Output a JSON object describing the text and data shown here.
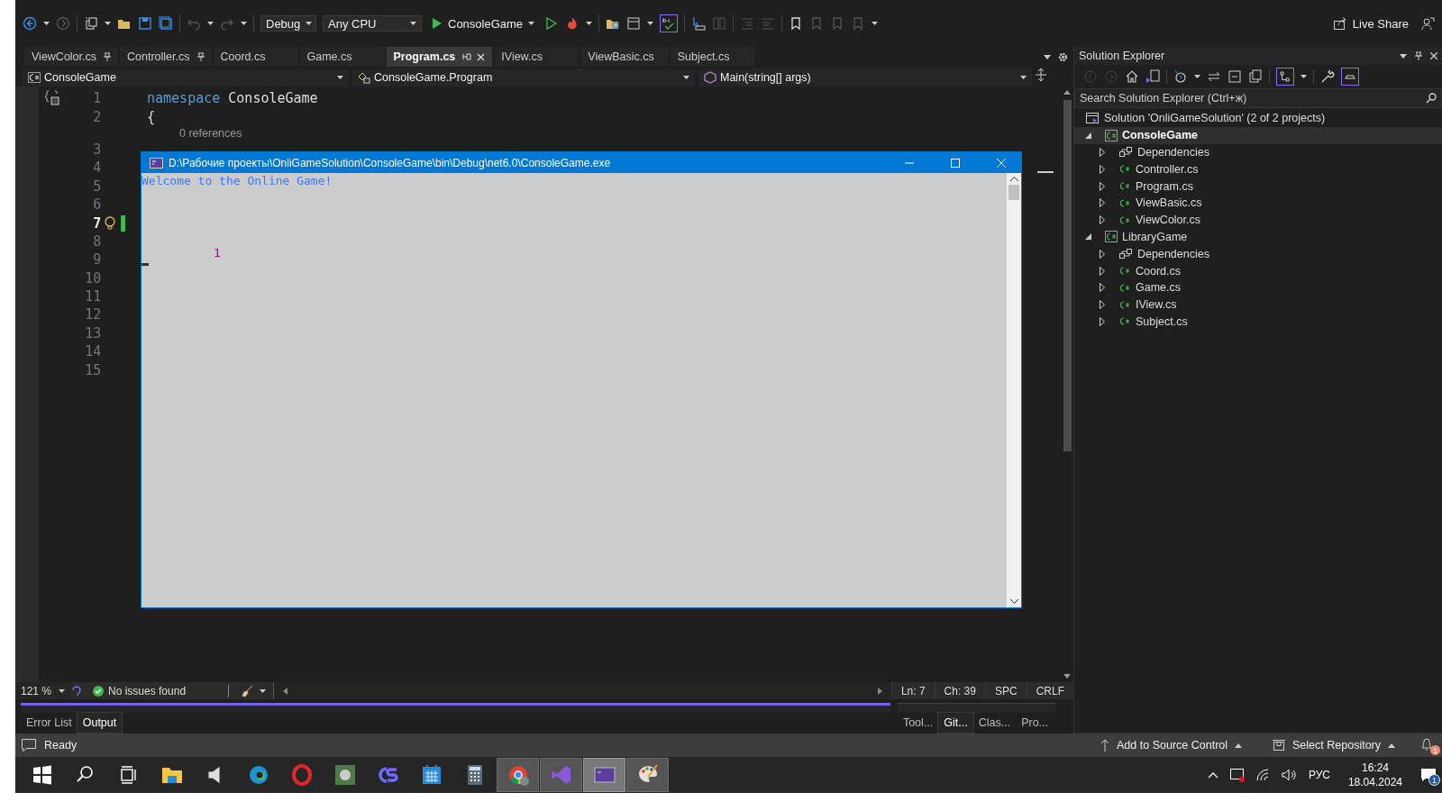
{
  "toolbar": {
    "configuration": "Debug",
    "platform": "Any CPU",
    "start_target": "ConsoleGame",
    "live_share": "Live Share"
  },
  "document_tabs": [
    {
      "label": "ViewColor.cs",
      "pinned": true,
      "selected": false
    },
    {
      "label": "Controller.cs",
      "pinned": true,
      "selected": false
    },
    {
      "label": "Coord.cs",
      "pinned": false,
      "selected": false
    },
    {
      "label": "Game.cs",
      "pinned": false,
      "selected": false
    },
    {
      "label": "Program.cs",
      "pinned": false,
      "selected": true
    },
    {
      "label": "IView.cs",
      "pinned": false,
      "selected": false
    },
    {
      "label": "ViewBasic.cs",
      "pinned": false,
      "selected": false
    },
    {
      "label": "Subject.cs",
      "pinned": false,
      "selected": false
    }
  ],
  "navigation_bar": {
    "project": "ConsoleGame",
    "type": "ConsoleGame.Program",
    "member": "Main(string[] args)"
  },
  "editor": {
    "lines": [
      {
        "kind": "code",
        "number": "1",
        "current": false,
        "tokens": [
          {
            "kind": "keyword",
            "text": "namespace"
          },
          {
            "kind": "plain",
            "text": " ConsoleGame"
          }
        ]
      },
      {
        "kind": "code",
        "number": "2",
        "current": false,
        "tokens": [
          {
            "kind": "plain",
            "text": "{"
          }
        ]
      },
      {
        "kind": "lens",
        "text": "0 references"
      },
      {
        "kind": "code",
        "number": "3",
        "current": false
      },
      {
        "kind": "code",
        "number": "4",
        "current": false
      },
      {
        "kind": "code",
        "number": "5",
        "current": false
      },
      {
        "kind": "code",
        "number": "6",
        "current": false
      },
      {
        "kind": "code",
        "number": "7",
        "current": true
      },
      {
        "kind": "code",
        "number": "8",
        "current": false
      },
      {
        "kind": "code",
        "number": "9",
        "current": false
      },
      {
        "kind": "code",
        "number": "10",
        "current": false
      },
      {
        "kind": "code",
        "number": "11",
        "current": false
      },
      {
        "kind": "code",
        "number": "12",
        "current": false
      },
      {
        "kind": "code",
        "number": "13",
        "current": false
      },
      {
        "kind": "code",
        "number": "14",
        "current": false
      },
      {
        "kind": "code",
        "number": "15",
        "current": false
      }
    ],
    "status": {
      "zoom": "121 %",
      "issues": "No issues found",
      "line": "Ln: 7",
      "column": "Ch: 39",
      "whitespace": "SPC",
      "line_endings": "CRLF"
    }
  },
  "console_window": {
    "title": "D:\\Рабочие проекты\\OnliGameSolution\\ConsoleGame\\bin\\Debug\\net6.0\\ConsoleGame.exe",
    "output": [
      {
        "text": "Welcome to the Online Game!",
        "color": "#3b78ff"
      },
      {
        "text": "1",
        "color": "#b4009e"
      }
    ]
  },
  "solution_explorer": {
    "title": "Solution Explorer",
    "search": {
      "placeholder": "Search Solution Explorer (Ctrl+ж)"
    },
    "tree": [
      {
        "kind": "solution",
        "label": "Solution 'OnliGameSolution' (2 of 2 projects)",
        "selected": false,
        "children": [
          {
            "kind": "project",
            "label": "ConsoleGame",
            "expanded": true,
            "selected": true,
            "children": [
              {
                "kind": "dependencies",
                "label": "Dependencies",
                "expanded": false,
                "selected": false
              },
              {
                "kind": "csharp",
                "label": "Controller.cs",
                "expanded": false,
                "selected": false
              },
              {
                "kind": "csharp",
                "label": "Program.cs",
                "expanded": false,
                "selected": false
              },
              {
                "kind": "csharp",
                "label": "ViewBasic.cs",
                "expanded": false,
                "selected": false
              },
              {
                "kind": "csharp",
                "label": "ViewColor.cs",
                "expanded": false,
                "selected": false
              }
            ]
          },
          {
            "kind": "project",
            "label": "LibraryGame",
            "expanded": true,
            "selected": false,
            "children": [
              {
                "kind": "dependencies",
                "label": "Dependencies",
                "expanded": false,
                "selected": false
              },
              {
                "kind": "csharp",
                "label": "Coord.cs",
                "expanded": false,
                "selected": false
              },
              {
                "kind": "csharp",
                "label": "Game.cs",
                "expanded": false,
                "selected": false
              },
              {
                "kind": "csharp",
                "label": "IView.cs",
                "expanded": false,
                "selected": false
              },
              {
                "kind": "csharp",
                "label": "Subject.cs",
                "expanded": false,
                "selected": false
              }
            ]
          }
        ]
      }
    ]
  },
  "bottom_tabs": [
    {
      "label": "Error List",
      "selected": false
    },
    {
      "label": "Output",
      "selected": true
    }
  ],
  "side_tabs": [
    {
      "label": "Tool...",
      "selected": false
    },
    {
      "label": "Git...",
      "selected": true
    },
    {
      "label": "Clas...",
      "selected": false
    },
    {
      "label": "Pro...",
      "selected": false
    }
  ],
  "status_bar": {
    "state": "Ready",
    "source_control": "Add to Source Control",
    "repository": "Select Repository",
    "notifications": "1"
  },
  "taskbar": {
    "items": [
      {
        "kind": "start",
        "running": false,
        "selected": false
      },
      {
        "kind": "search",
        "running": false,
        "selected": false
      },
      {
        "kind": "taskview",
        "running": false,
        "selected": false
      },
      {
        "kind": "explorer",
        "running": false,
        "selected": false
      },
      {
        "kind": "speaker",
        "running": false,
        "selected": false
      },
      {
        "kind": "edge",
        "running": false,
        "selected": false
      },
      {
        "kind": "opera",
        "running": false,
        "selected": false
      },
      {
        "kind": "game",
        "running": false,
        "selected": false
      },
      {
        "kind": "app",
        "running": false,
        "selected": false
      },
      {
        "kind": "calendar",
        "running": false,
        "selected": false
      },
      {
        "kind": "calculator",
        "running": false,
        "selected": false
      },
      {
        "kind": "chrome",
        "running": true,
        "selected": false
      },
      {
        "kind": "studio",
        "running": true,
        "selected": false
      },
      {
        "kind": "console",
        "running": true,
        "selected": true
      },
      {
        "kind": "paint",
        "running": true,
        "selected": false
      }
    ],
    "language": "РУС",
    "time": "16:24",
    "date": "18.04.2024",
    "notifications": "1"
  }
}
